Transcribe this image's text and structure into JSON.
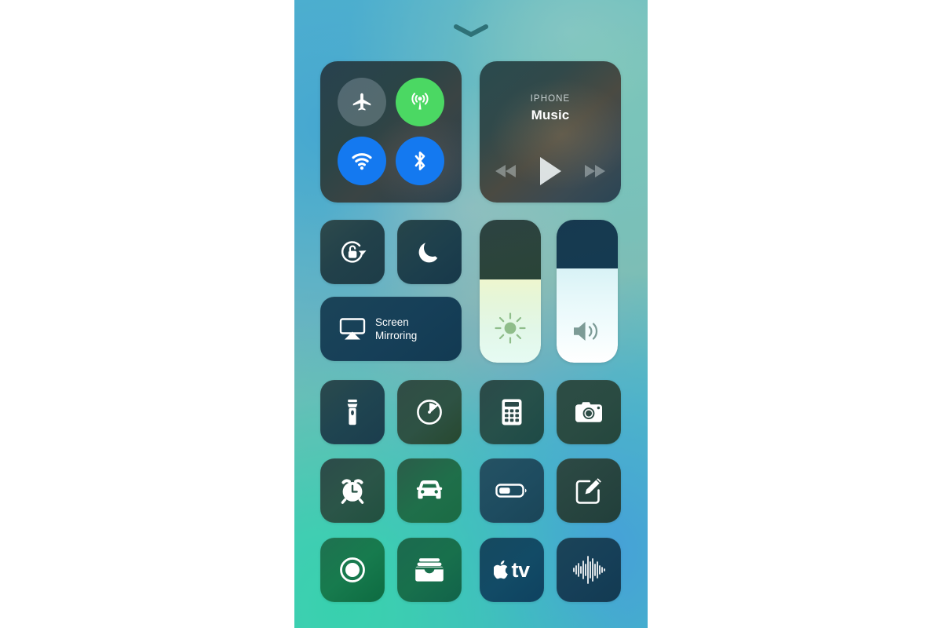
{
  "screen": {
    "name": "iOS Control Center",
    "handle_icon": "chevron-down-icon"
  },
  "connectivity": {
    "name": "Connectivity module",
    "buttons": [
      {
        "id": "airplane",
        "label": "Airplane Mode",
        "icon": "airplane-icon",
        "state": "off",
        "color": "rgba(178,196,205,0.30)"
      },
      {
        "id": "cellular",
        "label": "Cellular Data",
        "icon": "cellular-icon",
        "state": "on",
        "color": "#4bd863"
      },
      {
        "id": "wifi",
        "label": "Wi-Fi",
        "icon": "wifi-icon",
        "state": "on",
        "color": "#1479f0"
      },
      {
        "id": "bluetooth",
        "label": "Bluetooth",
        "icon": "bluetooth-icon",
        "state": "on",
        "color": "#1479f0"
      }
    ]
  },
  "media": {
    "source": "IPHONE",
    "title": "Music",
    "controls": [
      {
        "id": "previous",
        "label": "Previous Track",
        "icon": "rewind-icon",
        "state": "dimmed"
      },
      {
        "id": "play",
        "label": "Play",
        "icon": "play-icon",
        "state": "active"
      },
      {
        "id": "next",
        "label": "Next Track",
        "icon": "fast-forward-icon",
        "state": "dimmed"
      }
    ]
  },
  "toggles": {
    "rotation_lock": {
      "label": "Portrait Orientation Lock",
      "icon": "rotation-lock-icon",
      "state": "off"
    },
    "do_not_disturb": {
      "label": "Do Not Disturb",
      "icon": "moon-icon",
      "state": "off"
    },
    "screen_mirroring": {
      "label": "Screen\nMirroring",
      "icon": "airplay-icon",
      "state": "off"
    }
  },
  "sliders": {
    "brightness": {
      "label": "Brightness",
      "icon": "sun-icon",
      "value": 58,
      "unit": "%"
    },
    "volume": {
      "label": "Volume",
      "icon": "speaker-icon",
      "value": 66,
      "unit": "%"
    }
  },
  "shortcuts": [
    {
      "id": "flashlight",
      "label": "Flashlight",
      "icon": "flashlight-icon"
    },
    {
      "id": "timer",
      "label": "Timer",
      "icon": "timer-icon"
    },
    {
      "id": "calculator",
      "label": "Calculator",
      "icon": "calculator-icon"
    },
    {
      "id": "camera",
      "label": "Camera",
      "icon": "camera-icon"
    },
    {
      "id": "alarm",
      "label": "Alarm",
      "icon": "alarm-clock-icon"
    },
    {
      "id": "driving",
      "label": "Do Not Disturb While Driving",
      "icon": "car-icon"
    },
    {
      "id": "low-power",
      "label": "Low Power Mode",
      "icon": "battery-icon"
    },
    {
      "id": "notes",
      "label": "Notes",
      "icon": "notes-pencil-icon"
    },
    {
      "id": "screen-record",
      "label": "Screen Recording",
      "icon": "record-icon"
    },
    {
      "id": "wallet",
      "label": "Wallet",
      "icon": "wallet-icon"
    },
    {
      "id": "apple-tv-remote",
      "label": "Apple TV Remote",
      "icon": "apple-tv-icon"
    },
    {
      "id": "voice-memos",
      "label": "Voice Memos",
      "icon": "waveform-icon"
    }
  ],
  "apple_tv": {
    "wordmark": "tv"
  }
}
